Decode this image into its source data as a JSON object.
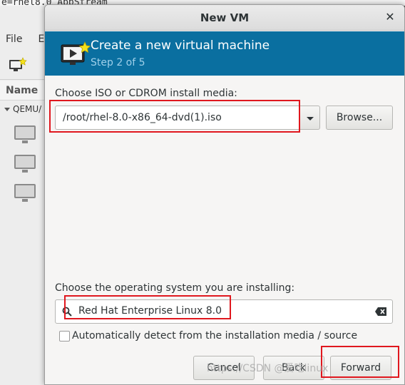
{
  "background": {
    "terminal_text": "e=rhel8.0 AppStream",
    "menu": [
      "File",
      "Ed"
    ],
    "column_header": "Name",
    "connection": "QEMU/"
  },
  "dialog": {
    "title": "New VM",
    "close_glyph": "✕",
    "banner": {
      "title": "Create a new virtual machine",
      "step": "Step 2 of 5",
      "color": "#0a6fa0"
    },
    "install_media": {
      "label": "Choose ISO or CDROM install media:",
      "value": "/root/rhel-8.0-x86_64-dvd(1).iso",
      "browse_label": "Browse..."
    },
    "os": {
      "label": "Choose the operating system you are installing:",
      "value": "Red Hat Enterprise Linux 8.0",
      "autodetect_label": "Automatically detect from the installation media / source",
      "autodetect_checked": false
    },
    "buttons": {
      "cancel": "Cancel",
      "back": "Back",
      "forward": "Forward"
    }
  },
  "watermark": "https://CSDN @爱吃linux",
  "highlight_color": "#e0171e"
}
